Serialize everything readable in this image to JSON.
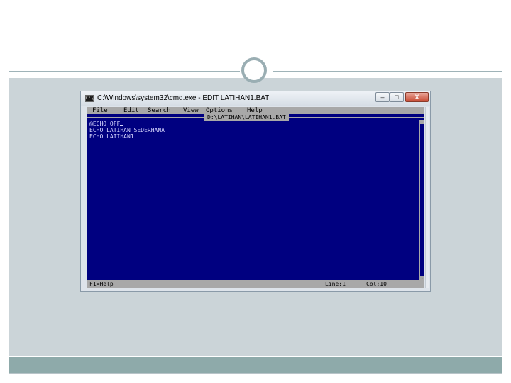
{
  "window": {
    "title": "C:\\Windows\\system32\\cmd.exe - EDIT  LATIHAN1.BAT",
    "icon_label": "C:\\",
    "minimize_glyph": "–",
    "maximize_glyph": "□",
    "close_glyph": "X"
  },
  "menu": {
    "items": [
      {
        "label": "File"
      },
      {
        "label": "Edit"
      },
      {
        "label": "Search"
      },
      {
        "label": "View"
      },
      {
        "label": "Options"
      },
      {
        "label": "Help"
      }
    ]
  },
  "editor": {
    "file_path": "D:\\LATIHAN\\LATIHAN1.BAT",
    "lines": [
      "@ECHO OFF",
      "ECHO LATIHAN SEDERHANA",
      "ECHO LATIHAN1"
    ]
  },
  "status": {
    "help": "F1=Help",
    "line": "Line:1",
    "col": "Col:10"
  },
  "colors": {
    "editor_background": "#000080",
    "menu_background": "#a8a8a8",
    "slide_band": "#8eaaaa"
  }
}
